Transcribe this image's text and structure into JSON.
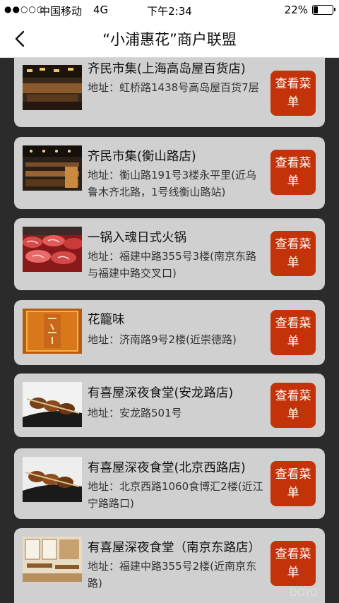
{
  "status": {
    "carrier": "中国移动",
    "network": "4G",
    "time": "下午2:34",
    "battery": "22%"
  },
  "nav": {
    "title": "“小浦惠花”商户联盟"
  },
  "button_label": "查看菜单",
  "merchants": [
    {
      "name": "齐民市集(上海高岛屋百货店)",
      "address": "地址：虹桥路1438号高岛屋百货7层",
      "thumb": "restaurant-interior-photo"
    },
    {
      "name": "齐民市集(衡山路店)",
      "address": "地址：衡山路191号3楼永平里(近乌鲁木齐北路，1号线衡山路站)",
      "thumb": "dining-hall-photo"
    },
    {
      "name": "一锅入魂日式火锅",
      "address": "地址：福建中路355号3楼(南京东路与福建中路交叉口)",
      "thumb": "sliced-beef-photo"
    },
    {
      "name": "花籠味",
      "address": "地址：济南路9号2楼(近崇德路)",
      "thumb": "calligraphy-sign-photo"
    },
    {
      "name": "有喜屋深夜食堂(安龙路店)",
      "address": "地址：安龙路501号",
      "thumb": "grilled-skewers-photo"
    },
    {
      "name": "有喜屋深夜食堂(北京西路店)",
      "address": "地址：北京西路1060食博汇2楼(近江宁路路口)",
      "thumb": "grilled-skewers-photo"
    },
    {
      "name": "有喜屋深夜食堂（南京东路店）",
      "address": "地址：福建中路355号2楼(近南京东路)",
      "thumb": "restaurant-room-photo"
    }
  ],
  "watermark": "DOYO"
}
